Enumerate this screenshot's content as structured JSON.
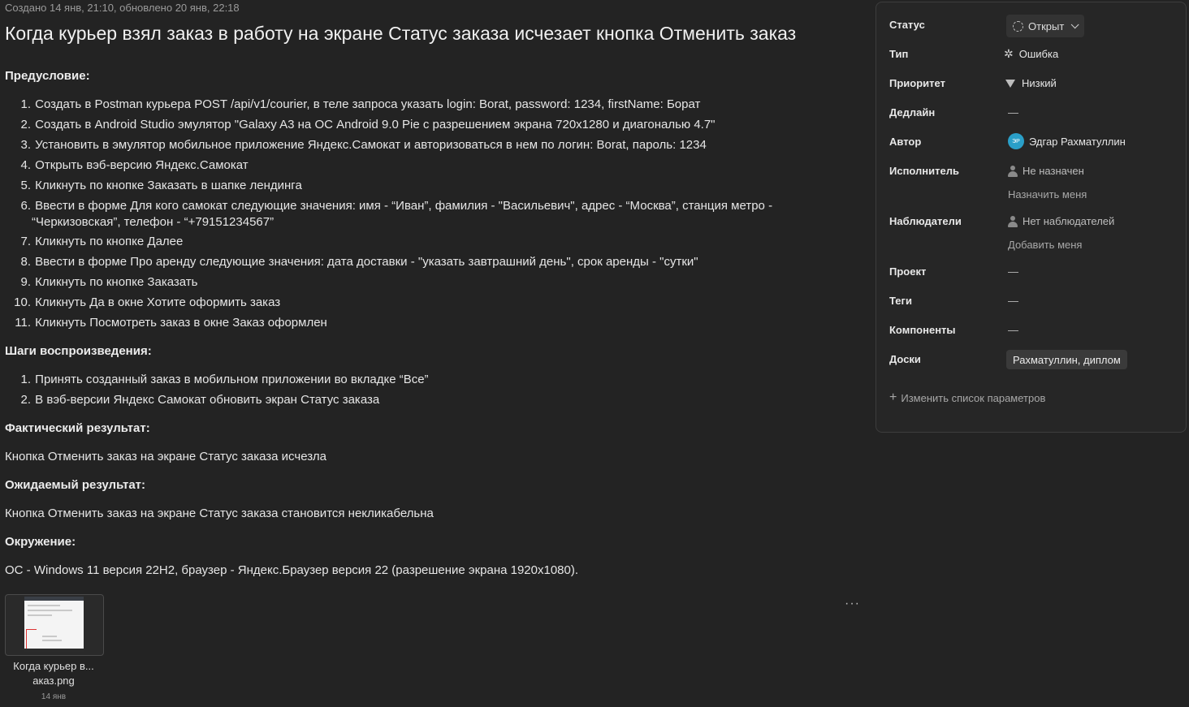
{
  "issue": {
    "meta": "Создано 14 янв, 21:10, обновлено 20 янв, 22:18",
    "title": "Когда курьер взял заказ в работу на экране Статус заказа исчезает кнопка Отменить заказ",
    "precondition_heading": "Предусловие:",
    "precondition_steps": [
      "Создать в Postman курьера POST /api/v1/courier, в теле запроса указать login: Borat, password: 1234, firstName: Борат",
      "Создать в Android Studio эмулятор \"Galaxy A3 на ОС Android 9.0 Pie с разрешением экрана 720x1280 и диагональю 4.7\"",
      "Установить в эмулятор мобильное приложение Яндекс.Самокат и авторизоваться в нем по логин: Borat, пароль: 1234",
      "Открыть вэб-версию Яндекс.Самокат",
      "Кликнуть по кнопке Заказать в шапке лендинга",
      "Ввести в форме Для кого самокат следующие значения: имя - “Иван”, фамилия - \"Васильевич\", адрес - “Москва”, станция метро -",
      "Кликнуть по кнопке Далее",
      "Ввести в форме Про аренду следующие значения: дата доставки - \"указать завтрашний день\", срок аренды - \"сутки\"",
      "Кликнуть по кнопке Заказать",
      "Кликнуть Да в окне Хотите оформить заказ",
      "Кликнуть Посмотреть заказ в окне Заказ оформлен"
    ],
    "precondition_step6_cont": "“Черкизовская”, телефон - “+79151234567”",
    "steps_heading": "Шаги воспроизведения:",
    "steps": [
      "Принять созданный заказ в мобильном приложении во вкладке “Все”",
      "В вэб-версии Яндекс Самокат обновить экран Статус заказа"
    ],
    "actual_heading": "Фактический результат:",
    "actual": "Кнопка Отменить заказ на экране Статус заказа исчезла",
    "expected_heading": "Ожидаемый результат:",
    "expected": "Кнопка Отменить заказ на экране Статус заказа становится некликабельна",
    "env_heading": "Окружение:",
    "env": "ОС - Windows 11 версия 22H2, браузер - Яндекс.Браузер версия 22 (разрешение экрана 1920x1080).",
    "attachment": {
      "name_line1": "Когда курьер в...",
      "name_line2": "аказ.png",
      "date": "14 янв"
    },
    "more_label": "···"
  },
  "sidebar": {
    "status_label": "Статус",
    "status_value": "Открыт",
    "type_label": "Тип",
    "type_value": "Ошибка",
    "priority_label": "Приоритет",
    "priority_value": "Низкий",
    "deadline_label": "Дедлайн",
    "deadline_value": "—",
    "author_label": "Автор",
    "author_initials": "ЭР",
    "author_value": "Эдгар Рахматуллин",
    "assignee_label": "Исполнитель",
    "assignee_value": "Не назначен",
    "assign_me": "Назначить меня",
    "watchers_label": "Наблюдатели",
    "watchers_value": "Нет наблюдателей",
    "add_me": "Добавить меня",
    "project_label": "Проект",
    "project_value": "—",
    "tags_label": "Теги",
    "tags_value": "—",
    "components_label": "Компоненты",
    "components_value": "—",
    "boards_label": "Доски",
    "boards_value": "Рахматуллин, диплом",
    "change_params": "Изменить список параметров"
  },
  "colors": {
    "background": "#232323",
    "panel": "#262626",
    "avatar": "#2a9fc8"
  }
}
